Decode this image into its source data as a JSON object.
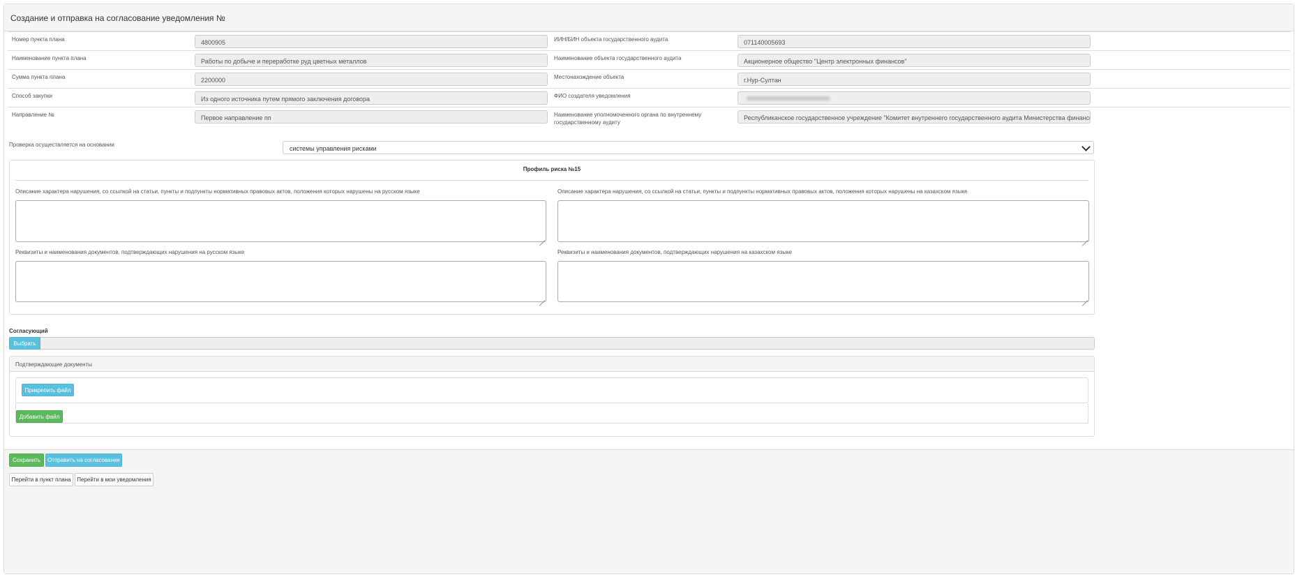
{
  "title": "Создание и отправка на согласование уведомления №",
  "fields_left": [
    {
      "label": "Номер пункта плана",
      "value": "4800905"
    },
    {
      "label": "Наименование пункта плана",
      "value": "Работы по добыче и переработке руд цветных металлов"
    },
    {
      "label": "Сумма пункта плана",
      "value": "2200000"
    },
    {
      "label": "Способ закупки",
      "value": "Из одного источника путем прямого заключения договора"
    },
    {
      "label": "Направление №",
      "value": "Первое направление пп"
    }
  ],
  "fields_right": [
    {
      "label": "ИИН/БИН объекта государственного аудита",
      "value": "071140005693"
    },
    {
      "label": "Наименование объекта государственного аудита",
      "value": "Акционерное общество \"Центр электронных финансов\""
    },
    {
      "label": "Местонахождение объекта",
      "value": "г.Нур-Султан"
    },
    {
      "label": "ФИО создателя уведомления",
      "value": ""
    },
    {
      "label": "Наименование уполномоченного органа по внутреннему государственному аудиту",
      "value": "Республиканское государственное учреждение \"Комитет внутреннего государственного аудита Министерства финансов Республики Казахстан\""
    }
  ],
  "basis": {
    "label": "Проверка осуществляется на основании",
    "selected": "системы управления рисками"
  },
  "risk_profile": {
    "title": "Профиль риска №15",
    "desc_ru_label": "Описание характера нарушения, со ссылкой на статьи, пункты и подпункты нормативных правовых актов, положения которых нарушены на русском языке",
    "desc_kz_label": "Описание характера нарушения, со ссылкой на статьи, пункты и подпункты нормативных правовых актов, положения которых нарушены на казахском языке",
    "docs_ru_label": "Реквизиты и наименования документов, подтверждающих нарушения на русском языке",
    "docs_kz_label": "Реквизиты и наименования документов, подтверждающих нарушения на казахском языке"
  },
  "approver": {
    "label": "Согласующий",
    "select_button": "Выбрать"
  },
  "documents": {
    "title": "Подтверждающие документы",
    "attach_button": "Прикрепить файл",
    "add_button": "Добавить файл"
  },
  "footer": {
    "save": "Сохранить",
    "send": "Отправить на согласование",
    "go_plan": "Перейти в пункт плана",
    "go_notifications": "Перейти в мои уведомления"
  }
}
